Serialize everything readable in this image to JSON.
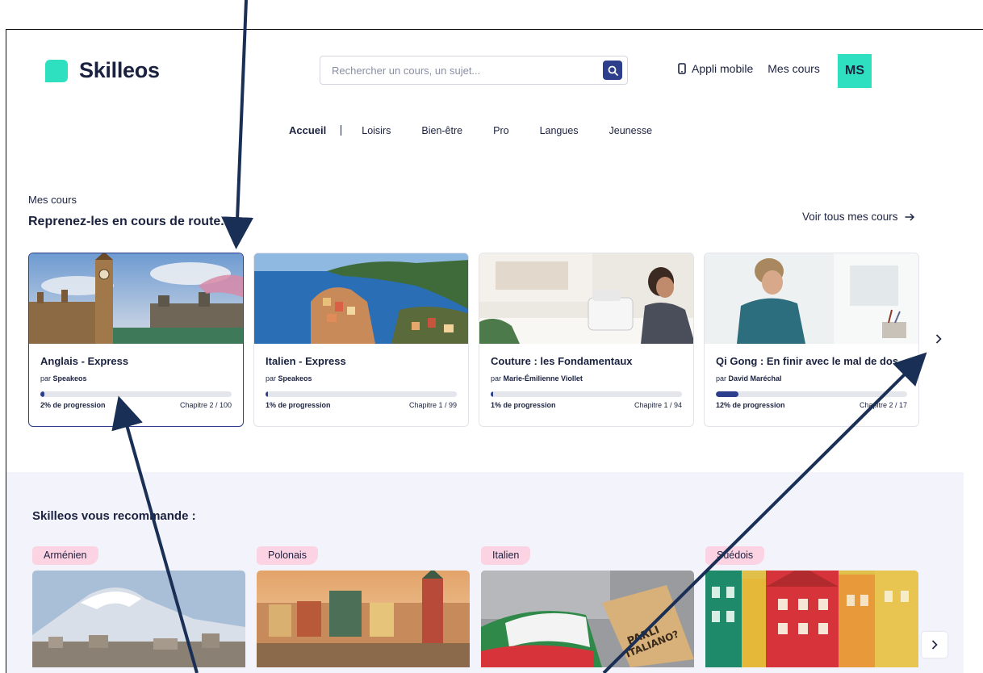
{
  "header": {
    "brand": "Skilleos",
    "search_placeholder": "Rechercher un cours, un sujet...",
    "app_link": "Appli mobile",
    "my_courses_link": "Mes cours",
    "avatar_initials": "MS"
  },
  "nav": {
    "items": [
      "Accueil",
      "Loisirs",
      "Bien-être",
      "Pro",
      "Langues",
      "Jeunesse"
    ],
    "active": "Accueil"
  },
  "my_courses": {
    "label": "Mes cours",
    "title": "Reprenez-les en cours de route.",
    "see_all": "Voir tous mes cours",
    "cards": [
      {
        "title": "Anglais - Express",
        "by": "par",
        "author": "Speakeos",
        "progress_text": "2% de progression",
        "chapter": "Chapitre 2 / 100",
        "progress": 0.02
      },
      {
        "title": "Italien - Express",
        "by": "par",
        "author": "Speakeos",
        "progress_text": "1% de progression",
        "chapter": "Chapitre 1 / 99",
        "progress": 0.01
      },
      {
        "title": "Couture : les Fondamentaux",
        "by": "par",
        "author": "Marie-Émilienne Viollet",
        "progress_text": "1% de progression",
        "chapter": "Chapitre 1 / 94",
        "progress": 0.01
      },
      {
        "title": "Qi Gong : En finir avec le mal de dos",
        "by": "par",
        "author": "David Maréchal",
        "progress_text": "12% de progression",
        "chapter": "Chapitre 2 / 17",
        "progress": 0.12
      }
    ]
  },
  "recommendations": {
    "title": "Skilleos vous recommande :",
    "cards": [
      {
        "tag": "Arménien"
      },
      {
        "tag": "Polonais"
      },
      {
        "tag": "Italien"
      },
      {
        "tag": "Suédois"
      }
    ]
  },
  "colors": {
    "brand_accent": "#2ee0c0",
    "primary": "#2d3f8c",
    "text": "#1b2240",
    "tag_bg": "#fbd3e2",
    "reco_bg": "#f3f4fb"
  }
}
